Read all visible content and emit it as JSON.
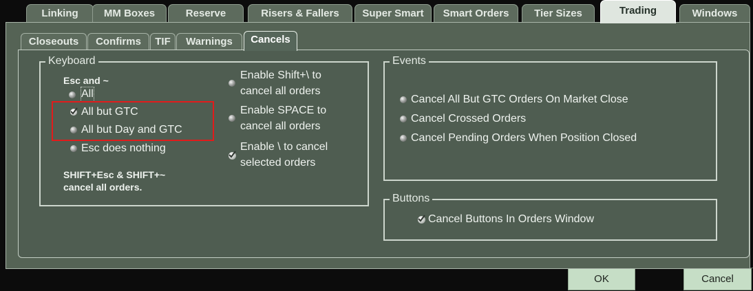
{
  "top_tabs": [
    "Linking",
    "MM Boxes",
    "Reserve",
    "Risers & Fallers",
    "Super Smart",
    "Smart Orders",
    "Tier Sizes",
    "Trading",
    "Windows"
  ],
  "active_top_tab": "Trading",
  "sub_tabs": [
    "Closeouts",
    "Confirms",
    "TIF",
    "Warnings",
    "Cancels"
  ],
  "active_sub_tab": "Cancels",
  "keyboard": {
    "title": "Keyboard",
    "esc_heading": "Esc and ~",
    "options": [
      {
        "label": "All",
        "selected": false
      },
      {
        "label": "All but GTC",
        "selected": true
      },
      {
        "label": "All but Day and GTC",
        "selected": false
      },
      {
        "label": "Esc does nothing",
        "selected": false
      }
    ],
    "note_line1": "SHIFT+Esc & SHIFT+~",
    "note_line2": "cancel all orders.",
    "toggles": [
      {
        "line1": "Enable Shift+\\ to",
        "line2": "cancel all orders",
        "checked": false
      },
      {
        "line1": "Enable SPACE to",
        "line2": "cancel all orders",
        "checked": false
      },
      {
        "line1": "Enable \\ to cancel",
        "line2": "selected orders",
        "checked": true
      }
    ]
  },
  "events": {
    "title": "Events",
    "items": [
      {
        "label": "Cancel All But GTC Orders On Market Close",
        "checked": false
      },
      {
        "label": "Cancel Crossed Orders",
        "checked": false
      },
      {
        "label": "Cancel Pending Orders When Position Closed",
        "checked": false
      }
    ]
  },
  "buttons_group": {
    "title": "Buttons",
    "items": [
      {
        "label": "Cancel Buttons In Orders Window",
        "checked": true
      }
    ]
  },
  "footer": {
    "ok_label": "OK",
    "cancel_label": "Cancel"
  }
}
